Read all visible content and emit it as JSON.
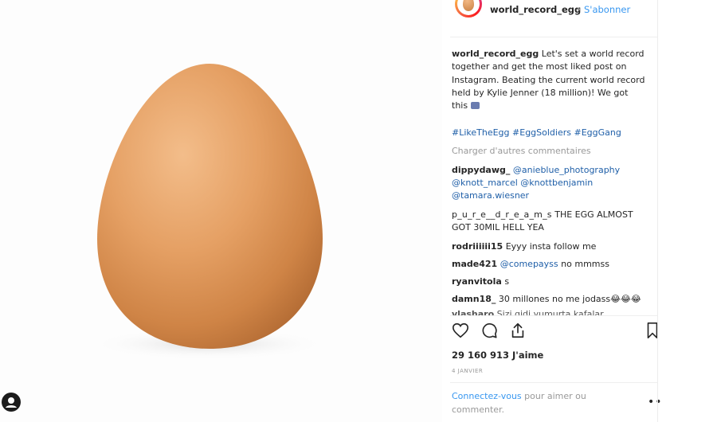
{
  "post": {
    "username": "world_record_egg",
    "dot": "•",
    "follow_label": "S'abonner"
  },
  "caption": {
    "username": "world_record_egg",
    "lines": [
      "Let's set a world record",
      "together and get the most liked post on",
      "Instagram. Beating the current world record",
      "held by Kylie Jenner (18 million)! We got",
      "this"
    ],
    "hashtags": [
      "#LikeTheEgg",
      "#EggSoldiers",
      "#EggGang"
    ]
  },
  "load_more_label": "Charger d'autres commentaires",
  "comments": [
    {
      "username": "dippydawg_",
      "mention1": "@anieblue_photography",
      "line2": "@knott_marcel @knottbenjamin",
      "line3": "@tamara.wiesner"
    },
    {
      "username": "p_u_r_e__d_r_e_a_m_s",
      "text": "THE EGG ALMOST",
      "line2": "GOT 30MIL HELL YEA"
    },
    {
      "username": "rodriiiiii15",
      "text": "Eyyy insta follow me"
    },
    {
      "username": "made421",
      "mention": "@comepayss",
      "text": "no mmmss"
    },
    {
      "username": "ryanvitola",
      "text": "s"
    },
    {
      "username": "damn18_",
      "text": "30 millones no me jodass😂😂😂"
    },
    {
      "username": "vlasharo",
      "text": "Sizi gidi yumurta kafalar"
    }
  ],
  "actions": {
    "like_icon": "heart-icon",
    "comment_icon": "comment-icon",
    "share_icon": "share-icon",
    "save_icon": "bookmark-icon"
  },
  "likes_count": "29 160 913 J'aime",
  "date": "4 JANVIER",
  "login_prompt": {
    "link": "Connectez-vous",
    "rest_line1": " pour aimer ou",
    "rest_line2": "commenter."
  },
  "more_icon": "••",
  "colors": {
    "link": "#3897f0",
    "hashtag": "#1f5fa8",
    "muted": "#999999",
    "egg": "#d88c4c"
  }
}
